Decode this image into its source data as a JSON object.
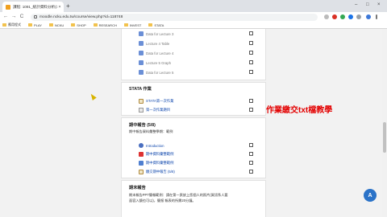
{
  "browser": {
    "tab_title": "課程: 1091_統計資料分析(1)(...",
    "tab_close": "×",
    "new_tab": "+",
    "window_controls": [
      "–",
      "□",
      "×"
    ],
    "nav": {
      "back": "←",
      "forward": "→",
      "reload": "C"
    },
    "url": "moodle.ncku.edu.tw/course/view.php?id=118748",
    "bookmarks": [
      "應用程式",
      "PLAY",
      "NCKU",
      "SHOP",
      "RESEARCH",
      "INVEST",
      "STATA"
    ]
  },
  "course": {
    "section_top": {
      "items": [
        {
          "label": "Data for Lecture 3",
          "icon": "folder-icon"
        },
        {
          "label": "Lecture 4 Table",
          "icon": "folder-icon"
        },
        {
          "label": "Data for Lecture 4",
          "icon": "folder-icon"
        },
        {
          "label": "Lecture 5 Graph",
          "icon": "folder-icon"
        },
        {
          "label": "Data for Lecture 5",
          "icon": "folder-icon"
        }
      ]
    },
    "section_stata": {
      "title": "STATA 作業",
      "items": [
        {
          "label": "STATA第一次作業",
          "icon": "assignment-icon"
        },
        {
          "label": "第一次作業題目",
          "icon": "page-icon"
        }
      ]
    },
    "section_midterm": {
      "title": "期中報告 (5/8)",
      "description": "期中報告資料彙整學期：範例",
      "items": [
        {
          "label": "Introduction",
          "icon": "link-icon"
        },
        {
          "label": "期中資料彙整範例",
          "icon": "pdf-icon"
        },
        {
          "label": "期中資料彙整範例",
          "icon": "ppt-icon"
        },
        {
          "label": "繳交期中報告 (5/8)",
          "icon": "assignment-icon"
        }
      ]
    },
    "section_final": {
      "title": "期末報告",
      "description_line1": "期末報告PPT簡報範例：請在第一頁放上您個人的照片(資訊系人要",
      "description_line2": "面容入鏡也可以)，簡报 報表的所需20分鐘。"
    }
  },
  "annotation": "作業繳交txt檔教學",
  "fab_label": "A"
}
